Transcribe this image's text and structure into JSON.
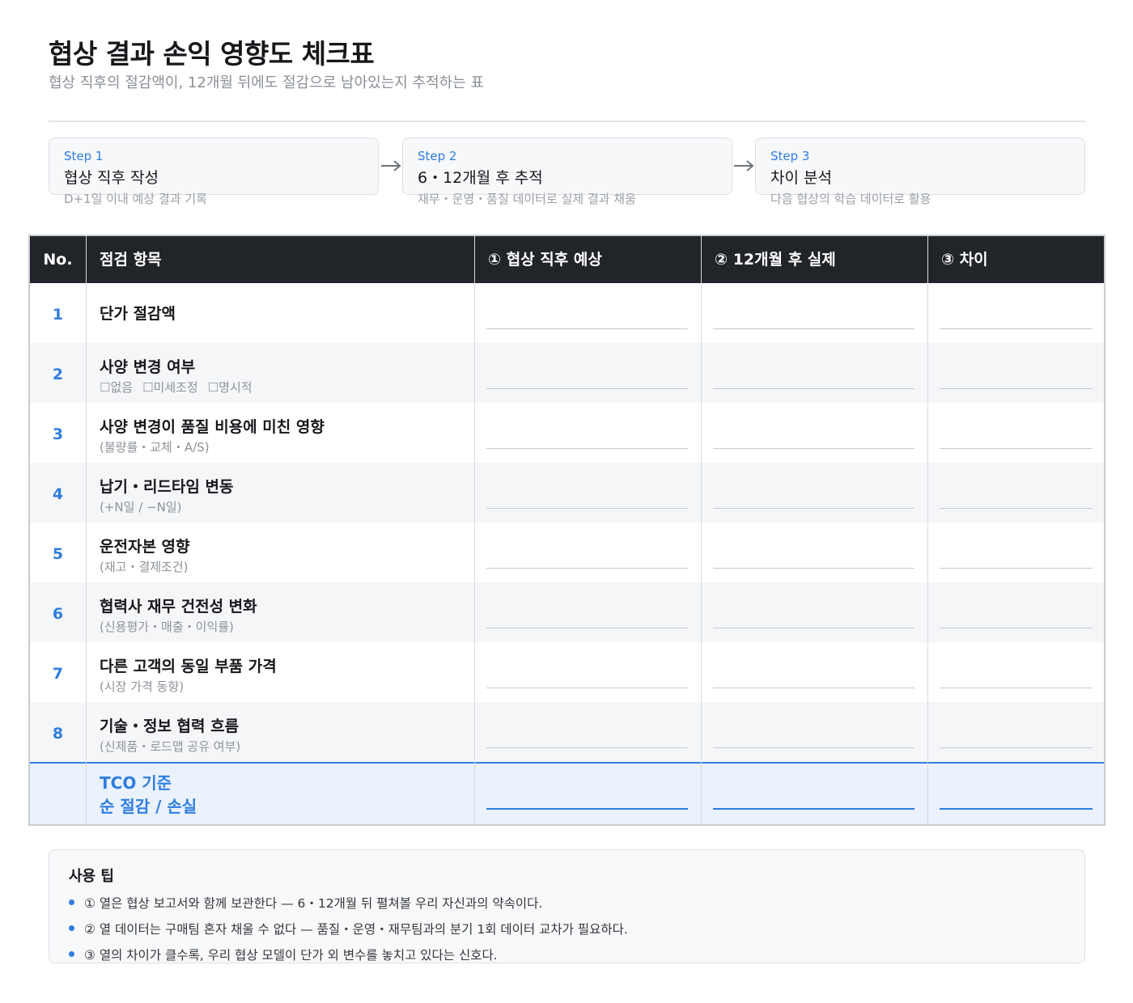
{
  "header": {
    "title": "협상 결과 손익 영향도 체크표",
    "subtitle": "협상 직후의 절감액이, 12개월 뒤에도 절감으로 남아있는지 추적하는 표"
  },
  "steps": [
    {
      "label": "Step 1",
      "title": "협상 직후 작성",
      "desc": "D+1일 이내 예상 결과 기록"
    },
    {
      "label": "Step 2",
      "title": "6・12개월 후 추적",
      "desc": "재무・운영・품질 데이터로 실제 결과 채움"
    },
    {
      "label": "Step 3",
      "title": "차이 분석",
      "desc": "다음 협상의 학습 데이터로 활용"
    }
  ],
  "table": {
    "headers": {
      "no": "No.",
      "item": "점검 항목",
      "col1": "① 협상 직후 예상",
      "col2": "② 12개월 후 실제",
      "col3": "③ 차이"
    },
    "rows": [
      {
        "no": "1",
        "item": "단가 절감액",
        "note": ""
      },
      {
        "no": "2",
        "item": "사양 변경 여부",
        "note": ""
      },
      {
        "no": "3",
        "item": "사양 변경이 품질 비용에 미친 영향",
        "note": "(불량률・교체・A/S)"
      },
      {
        "no": "4",
        "item": "납기・리드타임 변동",
        "note": "(+N일 / −N일)"
      },
      {
        "no": "5",
        "item": "운전자본 영향",
        "note": "(재고・결제조건)"
      },
      {
        "no": "6",
        "item": "협력사 재무 건전성 변화",
        "note": "(신용평가・매출・이익률)"
      },
      {
        "no": "7",
        "item": "다른 고객의 동일 부품 가격",
        "note": "(시장 가격 동향)"
      },
      {
        "no": "8",
        "item": "기술・정보 협력 흐름",
        "note": "(신제품・로드맵 공유 여부)"
      }
    ],
    "spec_options": [
      "없음",
      "미세조정",
      "명시적"
    ],
    "checkbox_glyph": "☐",
    "total": {
      "line1": "TCO 기준",
      "line2": "순 절감 / 손실"
    }
  },
  "tips": {
    "heading": "사용 팁",
    "items": [
      "① 열은 협상 보고서와 함께 보관한다 — 6・12개월 뒤 펼쳐볼 우리 자신과의 약속이다.",
      "② 열 데이터는 구매팀 혼자 채울 수 없다 — 품질・운영・재무팀과의 분기 1회 데이터 교차가 필요하다.",
      "③ 열의 차이가 클수록, 우리 협상 모델이 단가 외 변수를 놓치고 있다는 신호다."
    ]
  },
  "colors": {
    "accent": "#2f7de1",
    "header_bg": "#212428",
    "alt_row": "#f5f6f8",
    "total_bg": "#eaf2fd"
  }
}
